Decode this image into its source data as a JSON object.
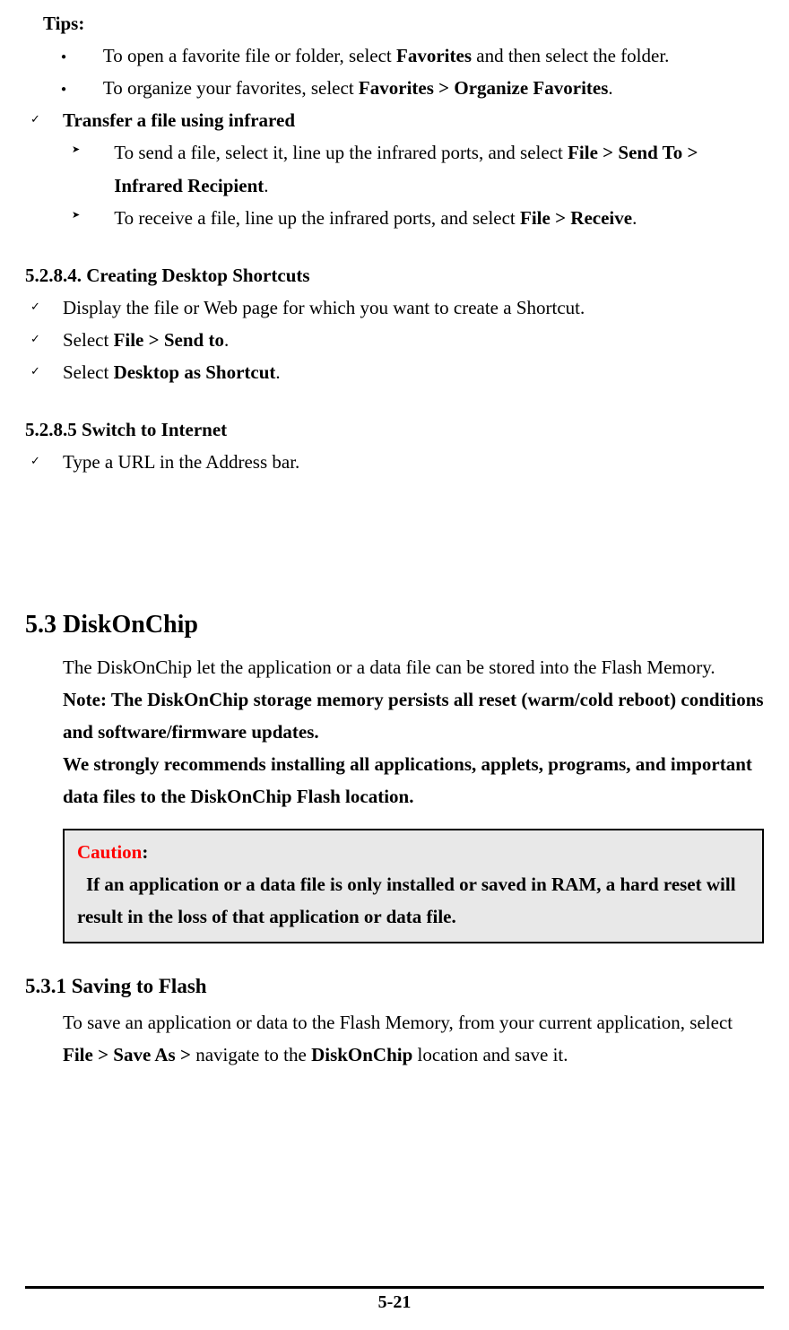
{
  "tips_label": "Tips:",
  "tips": {
    "i0": {
      "t1": "To open a favorite file or folder, select ",
      "b1": "Favorites",
      "t2": " and then select the folder."
    },
    "i1": {
      "t1": "To organize your favorites, select ",
      "b1": "Favorites > Organize Favorites",
      "t2": "."
    }
  },
  "transfer_heading": "Transfer a file using infrared",
  "transfer": {
    "i0": {
      "t1": "To send a file, select it, line up the infrared ports, and select ",
      "b1": "File > Send To > Infrared Recipient",
      "t2": "."
    },
    "i1": {
      "t1": "To receive a file, line up the infrared ports, and select ",
      "b1": "File > Receive",
      "t2": "."
    }
  },
  "sec_5284_heading": "5.2.8.4. Creating Desktop Shortcuts",
  "sec_5284": {
    "i0": {
      "t1": "Display the file or Web page for which you want to create a Shortcut."
    },
    "i1": {
      "t1": "Select ",
      "b1": "File > Send to",
      "t2": "."
    },
    "i2": {
      "t1": "Select ",
      "b1": "Desktop as Shortcut",
      "t2": "."
    }
  },
  "sec_5285_heading": "5.2.8.5 Switch to Internet",
  "sec_5285": {
    "i0": {
      "t1": "Type a URL in the Address bar."
    }
  },
  "sec_53_heading": "5.3 DiskOnChip",
  "sec_53_body1": "The DiskOnChip let the application or a data file can be stored into the Flash Memory.",
  "sec_53_note": "Note: The DiskOnChip storage memory persists all reset (warm/cold reboot) conditions and software/firmware updates.",
  "sec_53_reco": "We strongly recommends installing all applications, applets, programs, and important data files to the DiskOnChip Flash location.",
  "caution": {
    "label": "Caution",
    "colon": ":",
    "text": "If an application or a data file is only installed or saved in RAM, a hard reset will result in the loss of that application or data file."
  },
  "sec_531_heading": "5.3.1 Saving to Flash",
  "sec_531": {
    "t1": "To save an application or data to the Flash Memory, from your current application, select ",
    "b1": "File > Save As > ",
    "t2": "navigate to the ",
    "b2": "DiskOnChip",
    "t3": " location and save it."
  },
  "page_number": "5-21"
}
